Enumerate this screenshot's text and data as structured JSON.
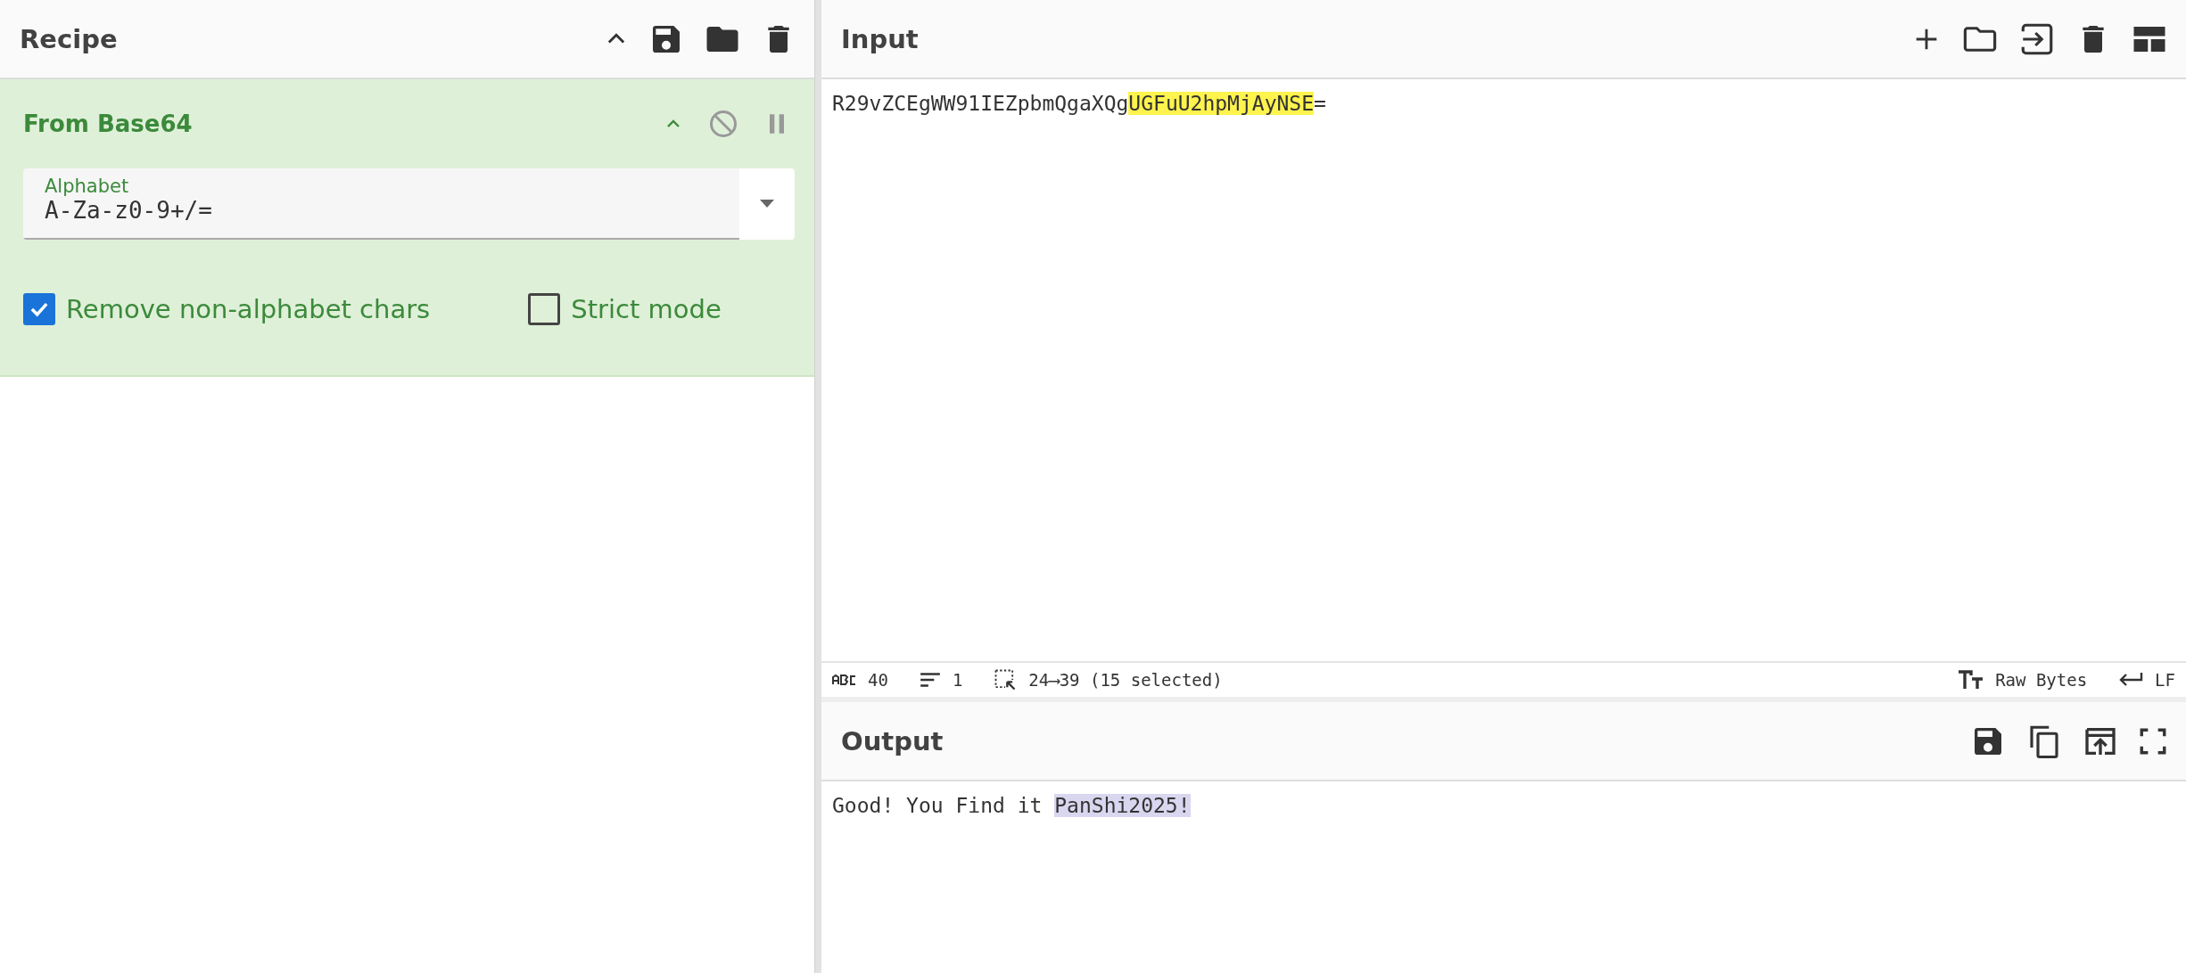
{
  "recipe": {
    "title": "Recipe"
  },
  "operations": [
    {
      "title": "From Base64",
      "expanded": true,
      "disabled": false,
      "paused": false,
      "field": {
        "label": "Alphabet",
        "value": "A-Za-z0-9+/="
      },
      "options": [
        {
          "label": "Remove non-alphabet chars",
          "checked": true
        },
        {
          "label": "Strict mode",
          "checked": false
        }
      ]
    }
  ],
  "input": {
    "title": "Input",
    "segments": [
      {
        "text": "R29vZCEgWW91IEZpbmQgaXQg",
        "highlighted": false
      },
      {
        "text": "UGFuU2hpMjAyNSE",
        "highlighted": true
      },
      {
        "text": "=",
        "highlighted": false
      }
    ]
  },
  "status_bar": {
    "length": "40",
    "lines": "1",
    "selection": "24⟶39 (15 selected)",
    "encoding": "Raw Bytes",
    "eol": "LF"
  },
  "output": {
    "title": "Output",
    "segments": [
      {
        "text": "Good! You Find it ",
        "highlighted": false
      },
      {
        "text": "PanShi2025!",
        "highlighted": true
      }
    ]
  }
}
